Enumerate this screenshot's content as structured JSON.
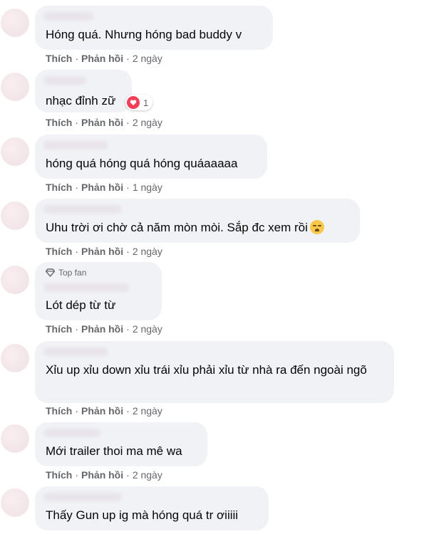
{
  "actions": {
    "like": "Thích",
    "reply": "Phản hồi",
    "sep": "·"
  },
  "comments": [
    {
      "text": "Hóng quá. Nhưng hóng bad buddy v",
      "time": "2 ngày"
    },
    {
      "text": "nhạc đỉnh zữ",
      "time": "2 ngày",
      "reaction_count": "1"
    },
    {
      "text": "hóng quá hóng quá hóng quáaaaaa",
      "time": "1 ngày"
    },
    {
      "text": "Uhu trời ơi chờ cả năm mòn mòi. Sắp đc xem rồi",
      "time": "2 ngày",
      "emoji": "crying-face"
    },
    {
      "badge": "Top fan",
      "text": "Lót dép từ từ",
      "time": "2 ngày"
    },
    {
      "text": "Xỉu up xỉu down xỉu trái xỉu phải xỉu từ nhà ra đến ngoài ngõ",
      "time": "2 ngày"
    },
    {
      "text": "Mới trailer thoi ma mê wa",
      "time": "2 ngày"
    },
    {
      "text": "Thấy Gun up ig mà hóng quá tr ơiiiii"
    }
  ],
  "colors": {
    "bubble": "#f0f2f5",
    "meta": "#65676b",
    "heart": "#f33e58"
  }
}
